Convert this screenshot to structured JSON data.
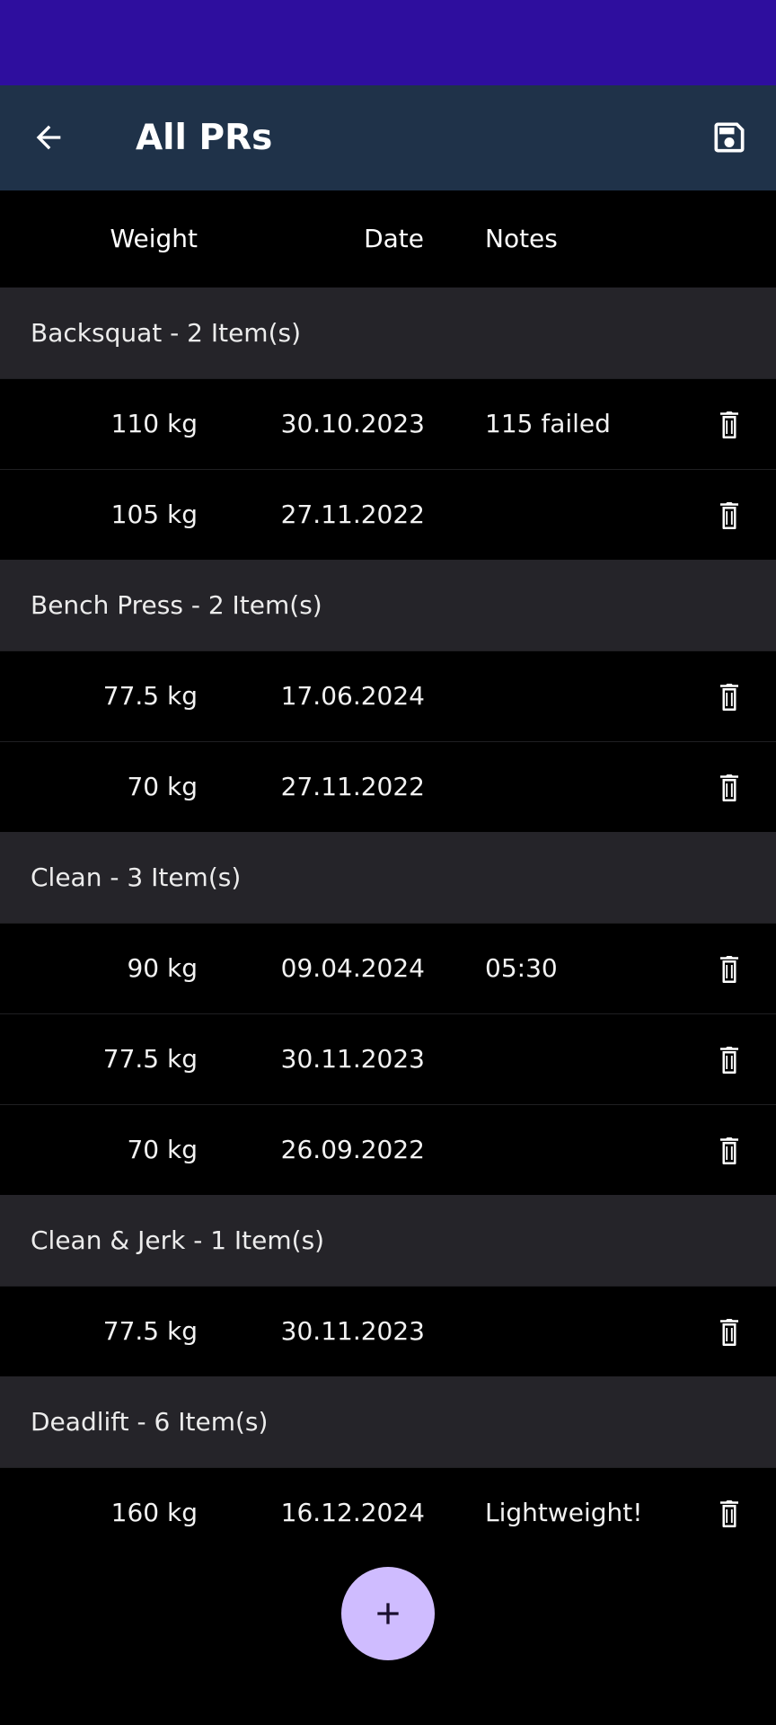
{
  "app_bar": {
    "title": "All PRs"
  },
  "columns": {
    "weight": "Weight",
    "date": "Date",
    "notes": "Notes"
  },
  "groups": [
    {
      "title": "Backsquat - 2 Item(s)",
      "rows": [
        {
          "weight": "110 kg",
          "date": "30.10.2023",
          "notes": "115 failed"
        },
        {
          "weight": "105 kg",
          "date": "27.11.2022",
          "notes": ""
        }
      ]
    },
    {
      "title": "Bench Press - 2 Item(s)",
      "rows": [
        {
          "weight": "77.5 kg",
          "date": "17.06.2024",
          "notes": ""
        },
        {
          "weight": "70 kg",
          "date": "27.11.2022",
          "notes": ""
        }
      ]
    },
    {
      "title": "Clean - 3 Item(s)",
      "rows": [
        {
          "weight": "90 kg",
          "date": "09.04.2024",
          "notes": "05:30"
        },
        {
          "weight": "77.5 kg",
          "date": "30.11.2023",
          "notes": ""
        },
        {
          "weight": "70 kg",
          "date": "26.09.2022",
          "notes": ""
        }
      ]
    },
    {
      "title": "Clean & Jerk - 1 Item(s)",
      "rows": [
        {
          "weight": "77.5 kg",
          "date": "30.11.2023",
          "notes": ""
        }
      ]
    },
    {
      "title": "Deadlift - 6 Item(s)",
      "rows": [
        {
          "weight": "160 kg",
          "date": "16.12.2024",
          "notes": "Lightweight!"
        }
      ]
    }
  ],
  "icons": {
    "back": "arrow-back-icon",
    "save": "save-icon",
    "delete": "trash-icon",
    "add": "plus-icon"
  },
  "colors": {
    "status_bar": "#2e0e9e",
    "app_bar": "#1f3249",
    "fab": "#cfbcff",
    "group_header": "#252429"
  }
}
